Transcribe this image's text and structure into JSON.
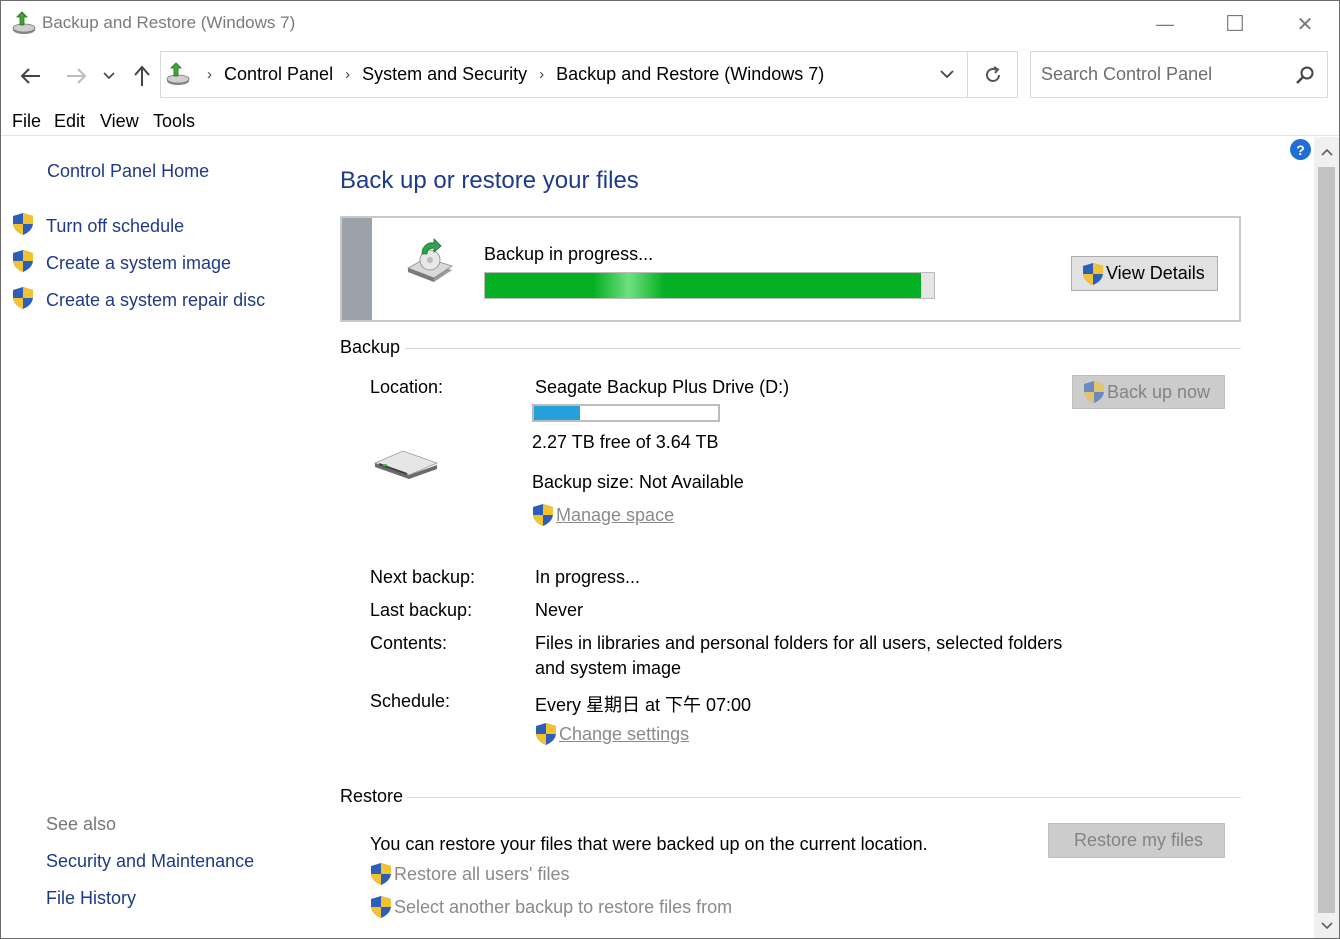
{
  "window": {
    "title": "Backup and Restore (Windows 7)",
    "controls": {
      "minimize": "—",
      "maximize": "☐",
      "close": "✕"
    }
  },
  "address": {
    "crumbs": [
      "Control Panel",
      "System and Security",
      "Backup and Restore (Windows 7)"
    ],
    "search_placeholder": "Search Control Panel"
  },
  "menu": [
    "File",
    "Edit",
    "View",
    "Tools"
  ],
  "left_pane": {
    "home": "Control Panel Home",
    "tasks": [
      "Turn off schedule",
      "Create a system image",
      "Create a system repair disc"
    ],
    "see_also_title": "See also",
    "see_also": [
      "Security and Maintenance",
      "File History"
    ]
  },
  "main": {
    "title": "Back up or restore your files",
    "progress": {
      "label": "Backup in progress...",
      "percent": 97,
      "view_details": "View Details"
    },
    "backup": {
      "section": "Backup",
      "location_label": "Location:",
      "location": "Seagate Backup Plus Drive (D:)",
      "drive_used_percent": 25,
      "free_space": "2.27 TB free of 3.64 TB",
      "backup_size": "Backup size: Not Available",
      "manage_space": "Manage space",
      "back_up_now": "Back up now",
      "next_backup_label": "Next backup:",
      "next_backup": "In progress...",
      "last_backup_label": "Last backup:",
      "last_backup": "Never",
      "contents_label": "Contents:",
      "contents_line1": "Files in libraries and personal folders for all users, selected folders",
      "contents_line2": "and system image",
      "schedule_label": "Schedule:",
      "schedule": "Every 星期日 at 下午 07:00",
      "change_settings": "Change settings"
    },
    "restore": {
      "section": "Restore",
      "description": "You can restore your files that were backed up on the current location.",
      "restore_my_files": "Restore my files",
      "restore_all_users": "Restore all users' files",
      "select_another": "Select another backup to restore files from"
    }
  },
  "colors": {
    "link": "#1e3a8a",
    "progress_green": "#06b025",
    "drive_blue": "#26a0da",
    "disabled_text": "#838383"
  }
}
